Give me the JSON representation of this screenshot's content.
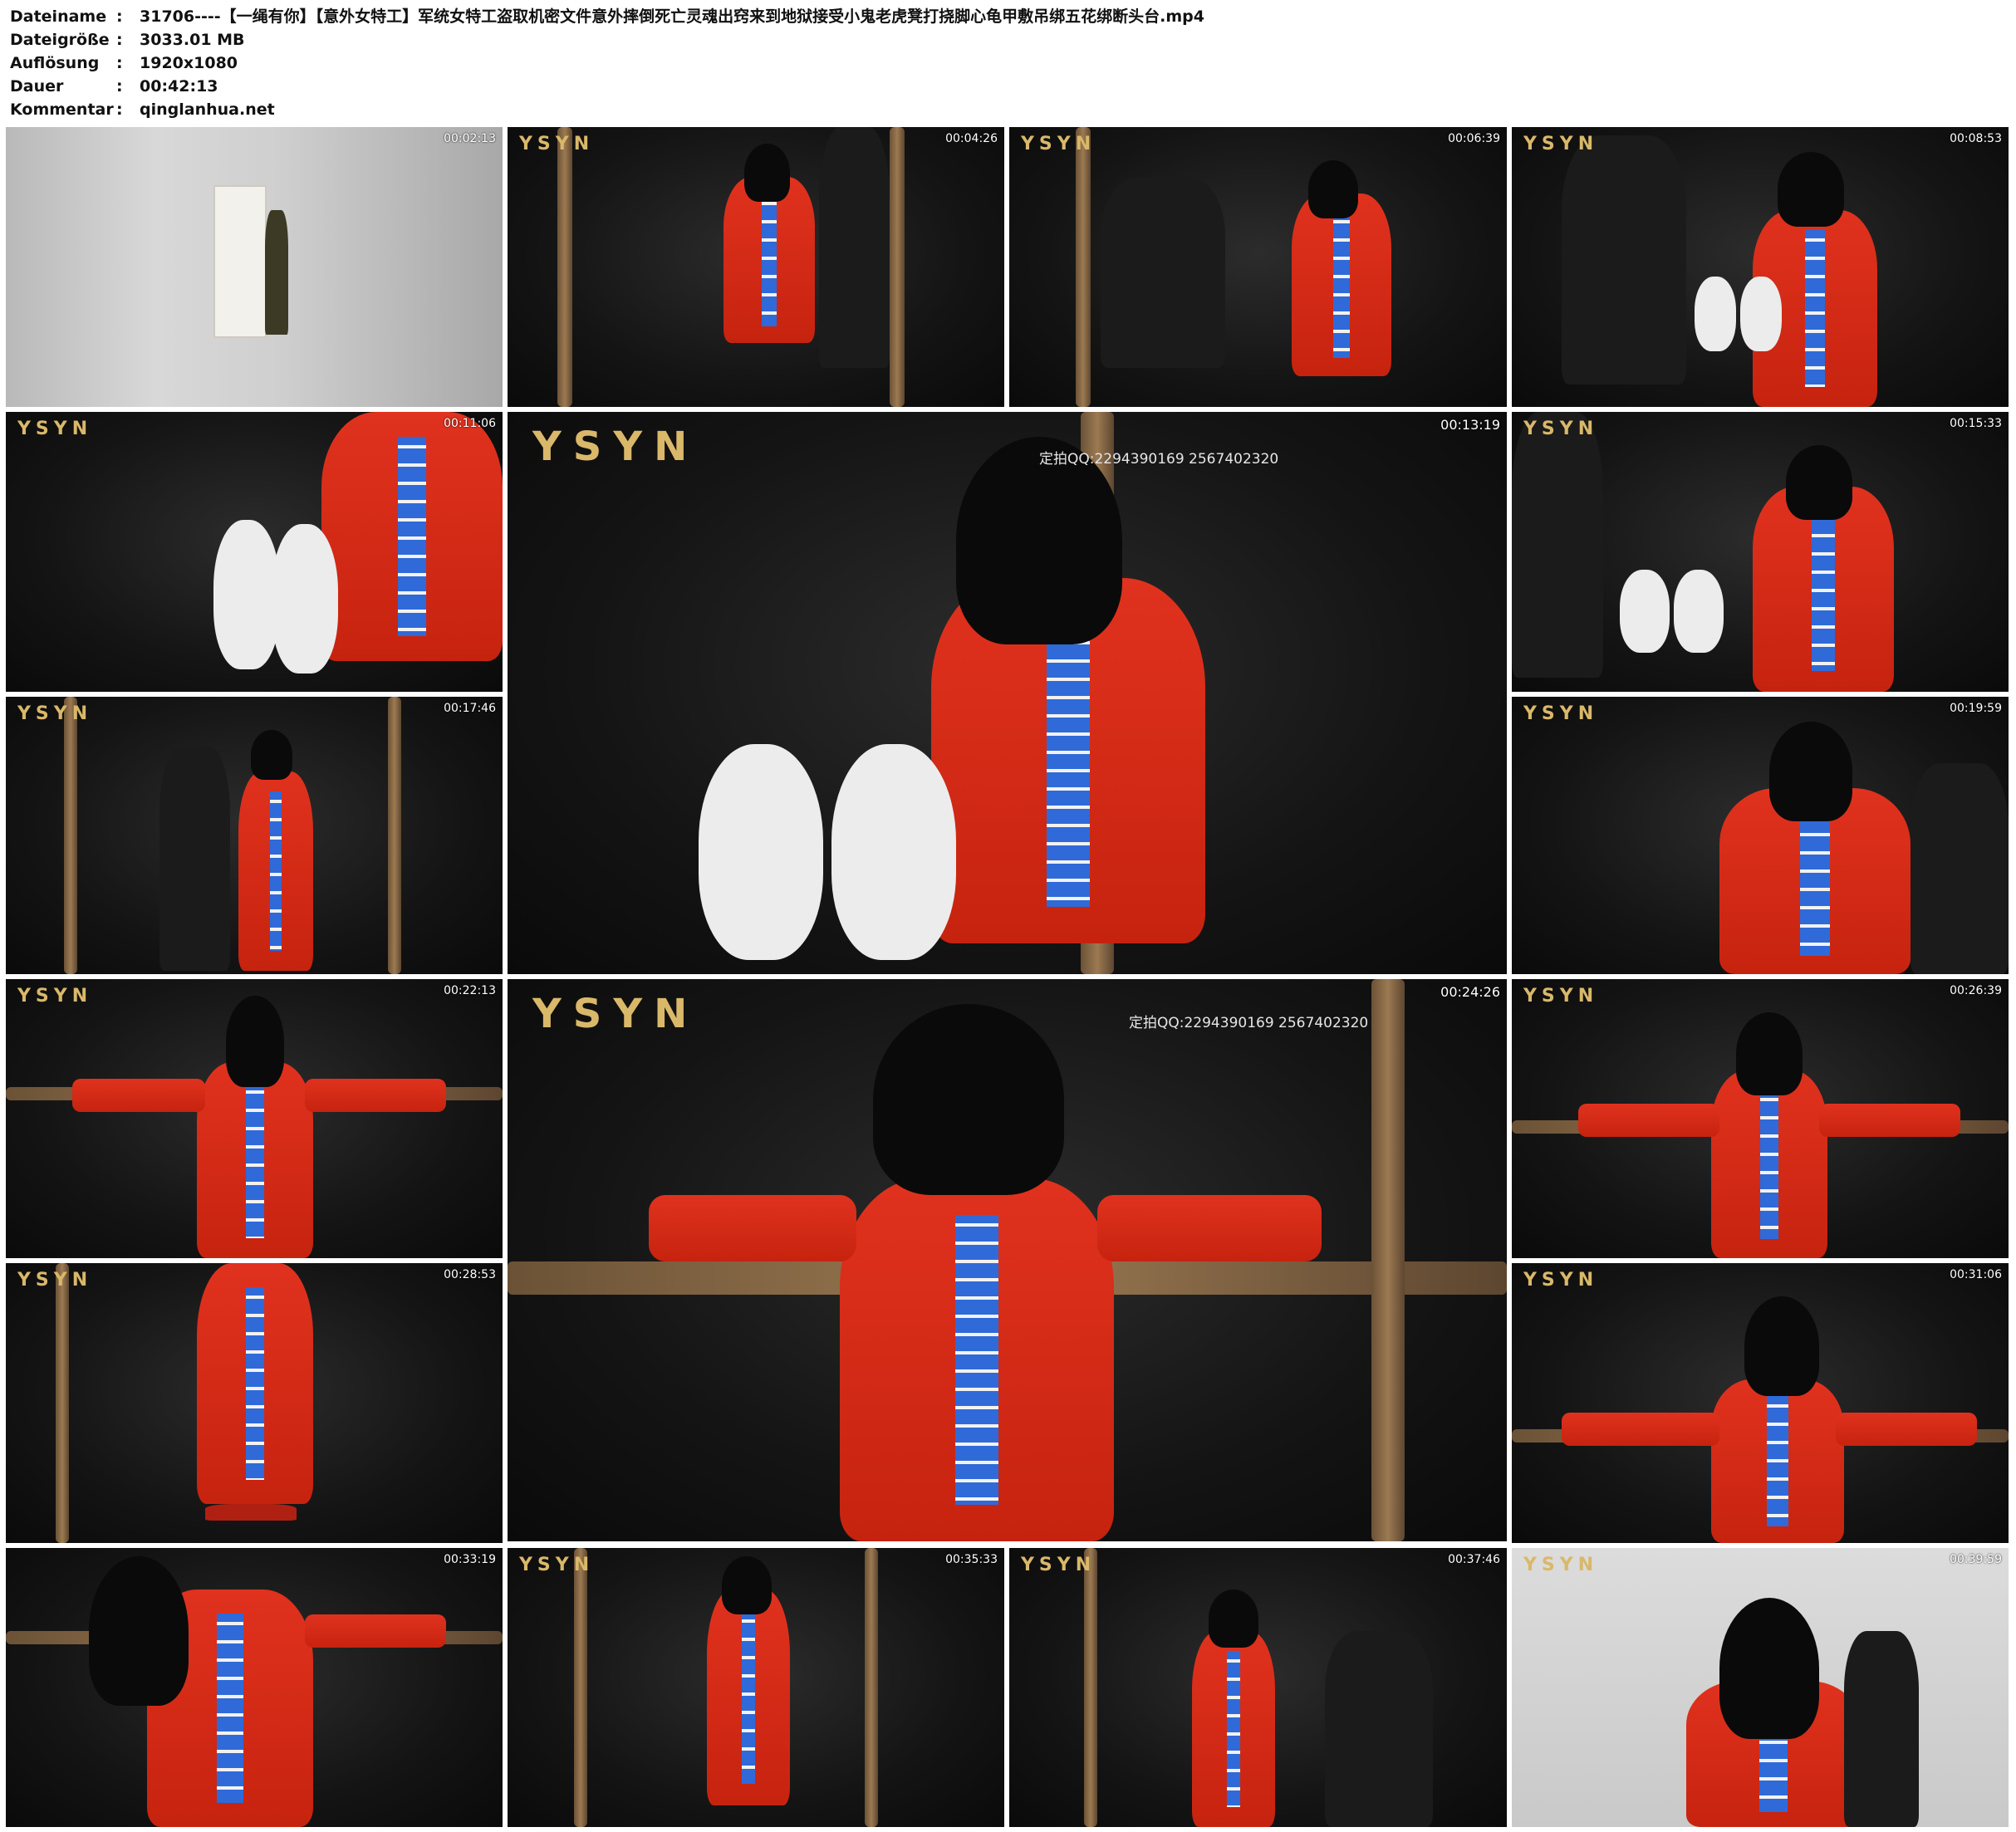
{
  "header": {
    "rows": [
      {
        "key": "Dateiname",
        "sep": ":",
        "value": "31706----【一绳有你】【意外女特工】军统女特工盗取机密文件意外摔倒死亡灵魂出窍来到地狱接受小鬼老虎凳打挠脚心龟甲敷吊绑五花绑断头台.mp4"
      },
      {
        "key": "Dateigröße",
        "sep": ":",
        "value": "3033.01 MB"
      },
      {
        "key": "Auflösung",
        "sep": ":",
        "value": "1920x1080"
      },
      {
        "key": "Dauer",
        "sep": ":",
        "value": "00:42:13"
      },
      {
        "key": "Kommentar",
        "sep": ":",
        "value": "qinglanhua.net"
      }
    ]
  },
  "logo_text": "YSYN",
  "watermark_text": "定拍QQ:2294390169  2567402320",
  "thumbnails": [
    {
      "time": "00:02:13"
    },
    {
      "time": "00:04:26"
    },
    {
      "time": "00:06:39"
    },
    {
      "time": "00:08:53"
    },
    {
      "time": "00:11:06"
    },
    {
      "time": "00:13:19"
    },
    {
      "time": "00:15:33"
    },
    {
      "time": "00:17:46"
    },
    {
      "time": "00:19:59"
    },
    {
      "time": "00:22:13"
    },
    {
      "time": "00:24:26"
    },
    {
      "time": "00:26:39"
    },
    {
      "time": "00:28:53"
    },
    {
      "time": "00:31:06"
    },
    {
      "time": "00:33:19"
    },
    {
      "time": "00:35:33"
    },
    {
      "time": "00:37:46"
    },
    {
      "time": "00:39:59"
    }
  ]
}
